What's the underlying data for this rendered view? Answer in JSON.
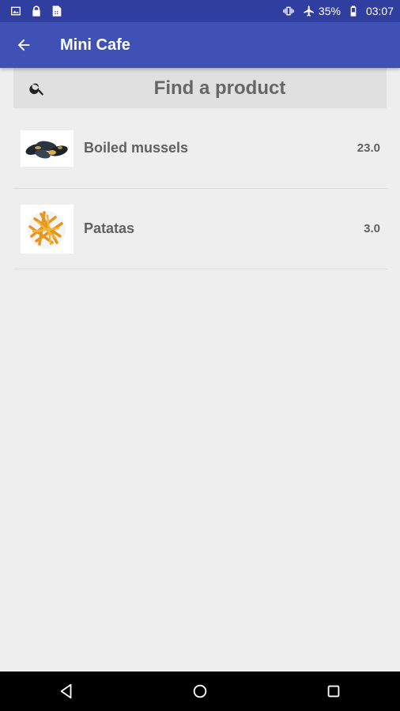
{
  "status_bar": {
    "battery": "35%",
    "time": "03:07",
    "left_icons": [
      "image-icon",
      "lock-icon",
      "sim-icon"
    ],
    "right_icons": [
      "vibrate-icon",
      "airplane-icon",
      "battery-icon"
    ]
  },
  "app_bar": {
    "title": "Mini Cafe",
    "back_icon": "arrow-back-icon",
    "color": "#3f51b5"
  },
  "search": {
    "placeholder": "Find a product",
    "value": ""
  },
  "products": [
    {
      "name": "Boiled mussels",
      "price": "23.0",
      "image": "mussels"
    },
    {
      "name": "Patatas",
      "price": "3.0",
      "image": "fries"
    }
  ],
  "nav_bar": {
    "buttons": [
      "back-triangle-icon",
      "home-circle-icon",
      "recents-square-icon"
    ]
  }
}
